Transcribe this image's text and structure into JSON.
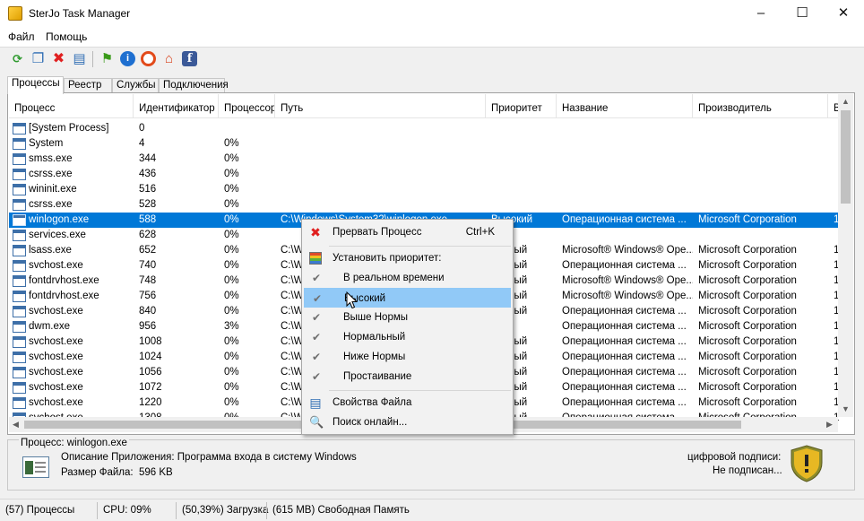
{
  "window": {
    "title": "SterJo Task Manager",
    "minimize": "–",
    "maximize": "☐",
    "close": "✕"
  },
  "menu": [
    "Файл",
    "Помощь"
  ],
  "toolbar_icons": [
    "refresh-icon",
    "windows-icon",
    "kill-process-icon",
    "properties-icon",
    "flag-icon",
    "info-icon",
    "help-icon",
    "home-icon",
    "facebook-icon"
  ],
  "tabs": [
    "Процессы",
    "Реестр",
    "Службы",
    "Подключения"
  ],
  "columns": [
    "Процесс",
    "Идентификатор",
    "Процессор",
    "Путь",
    "Приоритет",
    "Название",
    "Производитель",
    "В"
  ],
  "rows": [
    {
      "name": "[System Process]",
      "pid": "0",
      "cpu": "",
      "path": "",
      "priority": "",
      "title": "",
      "vendor": "",
      "extra": ""
    },
    {
      "name": "System",
      "pid": "4",
      "cpu": "0%",
      "path": "",
      "priority": "",
      "title": "",
      "vendor": "",
      "extra": ""
    },
    {
      "name": "smss.exe",
      "pid": "344",
      "cpu": "0%",
      "path": "",
      "priority": "",
      "title": "",
      "vendor": "",
      "extra": ""
    },
    {
      "name": "csrss.exe",
      "pid": "436",
      "cpu": "0%",
      "path": "",
      "priority": "",
      "title": "",
      "vendor": "",
      "extra": ""
    },
    {
      "name": "wininit.exe",
      "pid": "516",
      "cpu": "0%",
      "path": "",
      "priority": "",
      "title": "",
      "vendor": "",
      "extra": ""
    },
    {
      "name": "csrss.exe",
      "pid": "528",
      "cpu": "0%",
      "path": "",
      "priority": "",
      "title": "",
      "vendor": "",
      "extra": ""
    },
    {
      "name": "winlogon.exe",
      "pid": "588",
      "cpu": "0%",
      "path": "C:\\Windows\\System32\\winlogon.exe",
      "priority": "Высокий",
      "title": "Операционная система ...",
      "vendor": "Microsoft Corporation",
      "extra": "1",
      "selected": true
    },
    {
      "name": "services.exe",
      "pid": "628",
      "cpu": "0%",
      "path": "",
      "priority": "",
      "title": "",
      "vendor": "",
      "extra": ""
    },
    {
      "name": "lsass.exe",
      "pid": "652",
      "cpu": "0%",
      "path": "C:\\W",
      "priority": "альный",
      "title": "Microsoft® Windows® Ope...",
      "vendor": "Microsoft Corporation",
      "extra": "1"
    },
    {
      "name": "svchost.exe",
      "pid": "740",
      "cpu": "0%",
      "path": "C:\\W",
      "priority": "альный",
      "title": "Операционная система ...",
      "vendor": "Microsoft Corporation",
      "extra": "1"
    },
    {
      "name": "fontdrvhost.exe",
      "pid": "748",
      "cpu": "0%",
      "path": "C:\\W",
      "priority": "альный",
      "title": "Microsoft® Windows® Ope...",
      "vendor": "Microsoft Corporation",
      "extra": "1"
    },
    {
      "name": "fontdrvhost.exe",
      "pid": "756",
      "cpu": "0%",
      "path": "C:\\W",
      "priority": "альный",
      "title": "Microsoft® Windows® Ope...",
      "vendor": "Microsoft Corporation",
      "extra": "1"
    },
    {
      "name": "svchost.exe",
      "pid": "840",
      "cpu": "0%",
      "path": "C:\\W",
      "priority": "альный",
      "title": "Операционная система ...",
      "vendor": "Microsoft Corporation",
      "extra": "1"
    },
    {
      "name": "dwm.exe",
      "pid": "956",
      "cpu": "3%",
      "path": "C:\\W",
      "priority": "окий",
      "title": "Операционная система ...",
      "vendor": "Microsoft Corporation",
      "extra": "1"
    },
    {
      "name": "svchost.exe",
      "pid": "1008",
      "cpu": "0%",
      "path": "C:\\W",
      "priority": "альный",
      "title": "Операционная система ...",
      "vendor": "Microsoft Corporation",
      "extra": "1"
    },
    {
      "name": "svchost.exe",
      "pid": "1024",
      "cpu": "0%",
      "path": "C:\\W",
      "priority": "альный",
      "title": "Операционная система ...",
      "vendor": "Microsoft Corporation",
      "extra": "1"
    },
    {
      "name": "svchost.exe",
      "pid": "1056",
      "cpu": "0%",
      "path": "C:\\W",
      "priority": "альный",
      "title": "Операционная система ...",
      "vendor": "Microsoft Corporation",
      "extra": "1"
    },
    {
      "name": "svchost.exe",
      "pid": "1072",
      "cpu": "0%",
      "path": "C:\\W",
      "priority": "альный",
      "title": "Операционная система ...",
      "vendor": "Microsoft Corporation",
      "extra": "1"
    },
    {
      "name": "svchost.exe",
      "pid": "1220",
      "cpu": "0%",
      "path": "C:\\W",
      "priority": "альный",
      "title": "Операционная система ...",
      "vendor": "Microsoft Corporation",
      "extra": "1"
    },
    {
      "name": "svchost.exe",
      "pid": "1308",
      "cpu": "0%",
      "path": "C:\\W",
      "priority": "альный",
      "title": "Операционная система ...",
      "vendor": "Microsoft Corporation",
      "extra": "1"
    }
  ],
  "context_menu": {
    "kill": {
      "label": "Прервать Процесс",
      "shortcut": "Ctrl+K"
    },
    "set_priority": "Установить приоритет:",
    "priorities": [
      {
        "label": "В реальном времени",
        "checked": true
      },
      {
        "label": "Высокий",
        "checked": true,
        "highlighted": true
      },
      {
        "label": "Выше Нормы",
        "checked": true
      },
      {
        "label": "Нормальный",
        "checked": true
      },
      {
        "label": "Ниже Нормы",
        "checked": true
      },
      {
        "label": "Простаивание",
        "checked": true
      }
    ],
    "file_properties": "Свойства Файла",
    "search_online": "Поиск онлайн..."
  },
  "info": {
    "process_label": "Процесс: winlogon.exe",
    "description": "Описание Приложения: Программа входа в систему Windows",
    "file_size_label": "Размер Файла:",
    "file_size": "596 KB",
    "signature_label": "цифровой подписи:",
    "signature_value": "Не подписан..."
  },
  "status": {
    "processes": "(57) Процессы",
    "cpu": "CPU: 09%",
    "load": "(50,39%) Загрузка",
    "free_memory": "(615 MB) Свободная Память"
  },
  "colors": {
    "selection": "#0078d7",
    "menu_highlight": "#91c9f7"
  }
}
